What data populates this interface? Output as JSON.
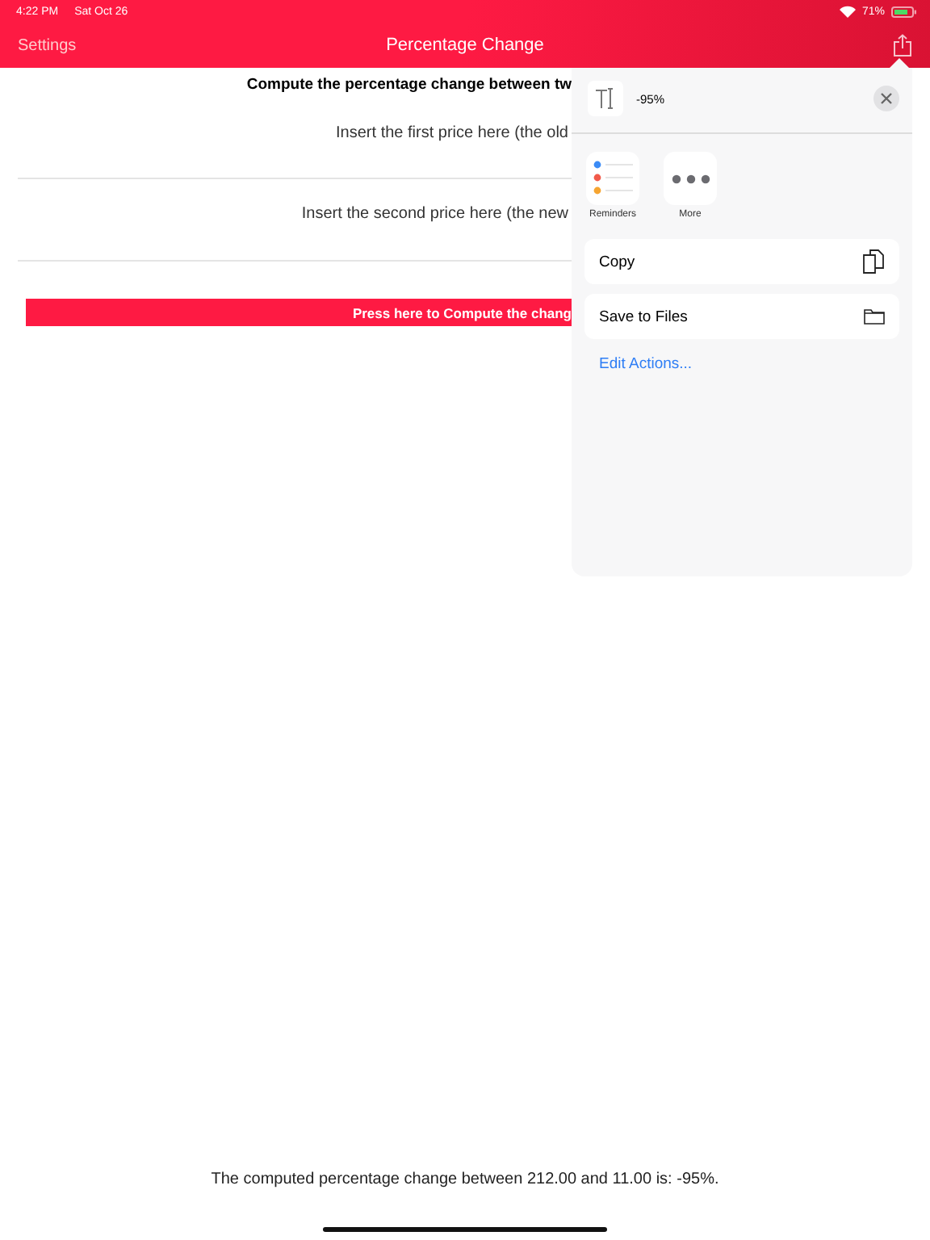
{
  "status_bar": {
    "time": "4:22 PM",
    "date": "Sat Oct 26",
    "battery": "71%"
  },
  "nav_bar": {
    "back": "Settings",
    "title": "Percentage Change"
  },
  "form": {
    "heading": "Compute the percentage change between tw",
    "fields": [
      {
        "placeholder": "Insert the first price here (the old"
      },
      {
        "placeholder": "Insert the second price here (the new"
      }
    ],
    "button": "Press here to Compute the chang"
  },
  "result": "The computed percentage change between 212.00 and 11.00 is: -95%.",
  "share_sheet": {
    "preview": "-95%",
    "apps": [
      {
        "kind": "reminders",
        "label": "Reminders"
      },
      {
        "kind": "more",
        "label": "More"
      }
    ],
    "actions": [
      {
        "kind": "copy",
        "label": "Copy"
      },
      {
        "kind": "folder",
        "label": "Save to Files"
      }
    ],
    "edit": "Edit Actions..."
  }
}
